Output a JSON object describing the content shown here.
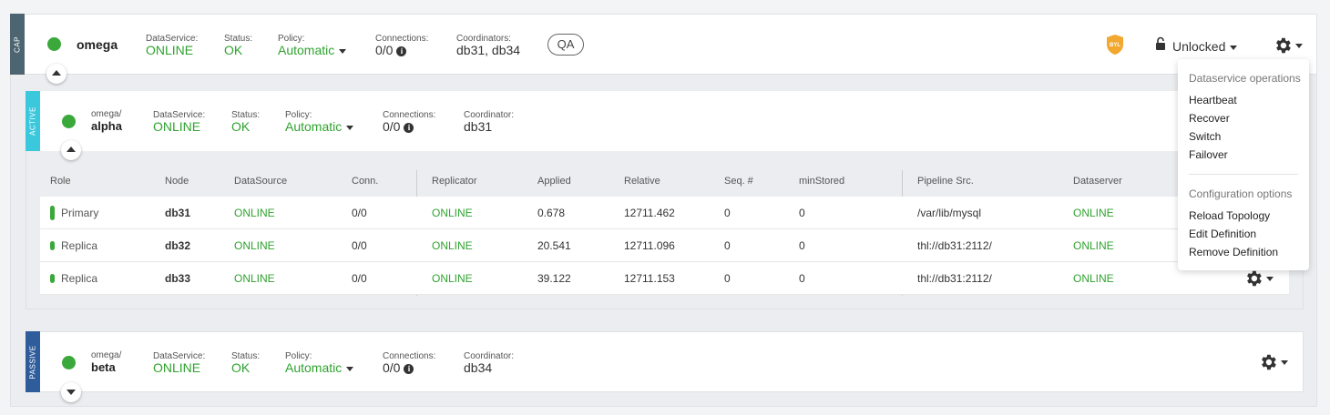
{
  "cluster": {
    "side_tab": "CAP",
    "name": "omega",
    "dataservice_label": "DataService:",
    "dataservice_value": "ONLINE",
    "status_label": "Status:",
    "status_value": "OK",
    "policy_label": "Policy:",
    "policy_value": "Automatic",
    "connections_label": "Connections:",
    "connections_value": "0/0",
    "coordinators_label": "Coordinators:",
    "coordinators_value": "db31, db34",
    "tag": "QA",
    "badge_text": "BYL",
    "lock_label": "Unlocked"
  },
  "alpha": {
    "side_tab": "ACTIVE",
    "parent": "omega/",
    "name": "alpha",
    "dataservice_label": "DataService:",
    "dataservice_value": "ONLINE",
    "status_label": "Status:",
    "status_value": "OK",
    "policy_label": "Policy:",
    "policy_value": "Automatic",
    "connections_label": "Connections:",
    "connections_value": "0/0",
    "coordinator_label": "Coordinator:",
    "coordinator_value": "db31"
  },
  "table": {
    "headers": [
      "Role",
      "Node",
      "DataSource",
      "Conn.",
      "Replicator",
      "Applied",
      "Relative",
      "Seq. #",
      "minStored",
      "Pipeline Src.",
      "Dataserver"
    ],
    "rows": [
      {
        "role": "Primary",
        "node": "db31",
        "datasource": "ONLINE",
        "conn": "0/0",
        "replicator": "ONLINE",
        "applied": "0.678",
        "relative": "12711.462",
        "seq": "0",
        "minstored": "0",
        "pipeline": "/var/lib/mysql",
        "dataserver": "ONLINE"
      },
      {
        "role": "Replica",
        "node": "db32",
        "datasource": "ONLINE",
        "conn": "0/0",
        "replicator": "ONLINE",
        "applied": "20.541",
        "relative": "12711.096",
        "seq": "0",
        "minstored": "0",
        "pipeline": "thl://db31:2112/",
        "dataserver": "ONLINE"
      },
      {
        "role": "Replica",
        "node": "db33",
        "datasource": "ONLINE",
        "conn": "0/0",
        "replicator": "ONLINE",
        "applied": "39.122",
        "relative": "12711.153",
        "seq": "0",
        "minstored": "0",
        "pipeline": "thl://db31:2112/",
        "dataserver": "ONLINE"
      }
    ]
  },
  "beta": {
    "side_tab": "PASSIVE",
    "parent": "omega/",
    "name": "beta",
    "dataservice_label": "DataService:",
    "dataservice_value": "ONLINE",
    "status_label": "Status:",
    "status_value": "OK",
    "policy_label": "Policy:",
    "policy_value": "Automatic",
    "connections_label": "Connections:",
    "connections_value": "0/0",
    "coordinator_label": "Coordinator:",
    "coordinator_value": "db34"
  },
  "menu": {
    "section1_header": "Dataservice operations",
    "section1_items": [
      "Heartbeat",
      "Recover",
      "Switch",
      "Failover"
    ],
    "section2_header": "Configuration options",
    "section2_items": [
      "Reload Topology",
      "Edit Definition",
      "Remove Definition"
    ]
  },
  "icons": {
    "status_dot": "status-online-dot",
    "lock": "unlock-icon",
    "settings": "gear-icon",
    "badge": "shield-badge-icon",
    "info": "info-icon"
  },
  "colors": {
    "online_green": "#2fa32f",
    "cap_tab": "#4d6570",
    "active_tab": "#3cc8dc",
    "passive_tab": "#2f5d9c",
    "badge_orange": "#f2a72e"
  }
}
